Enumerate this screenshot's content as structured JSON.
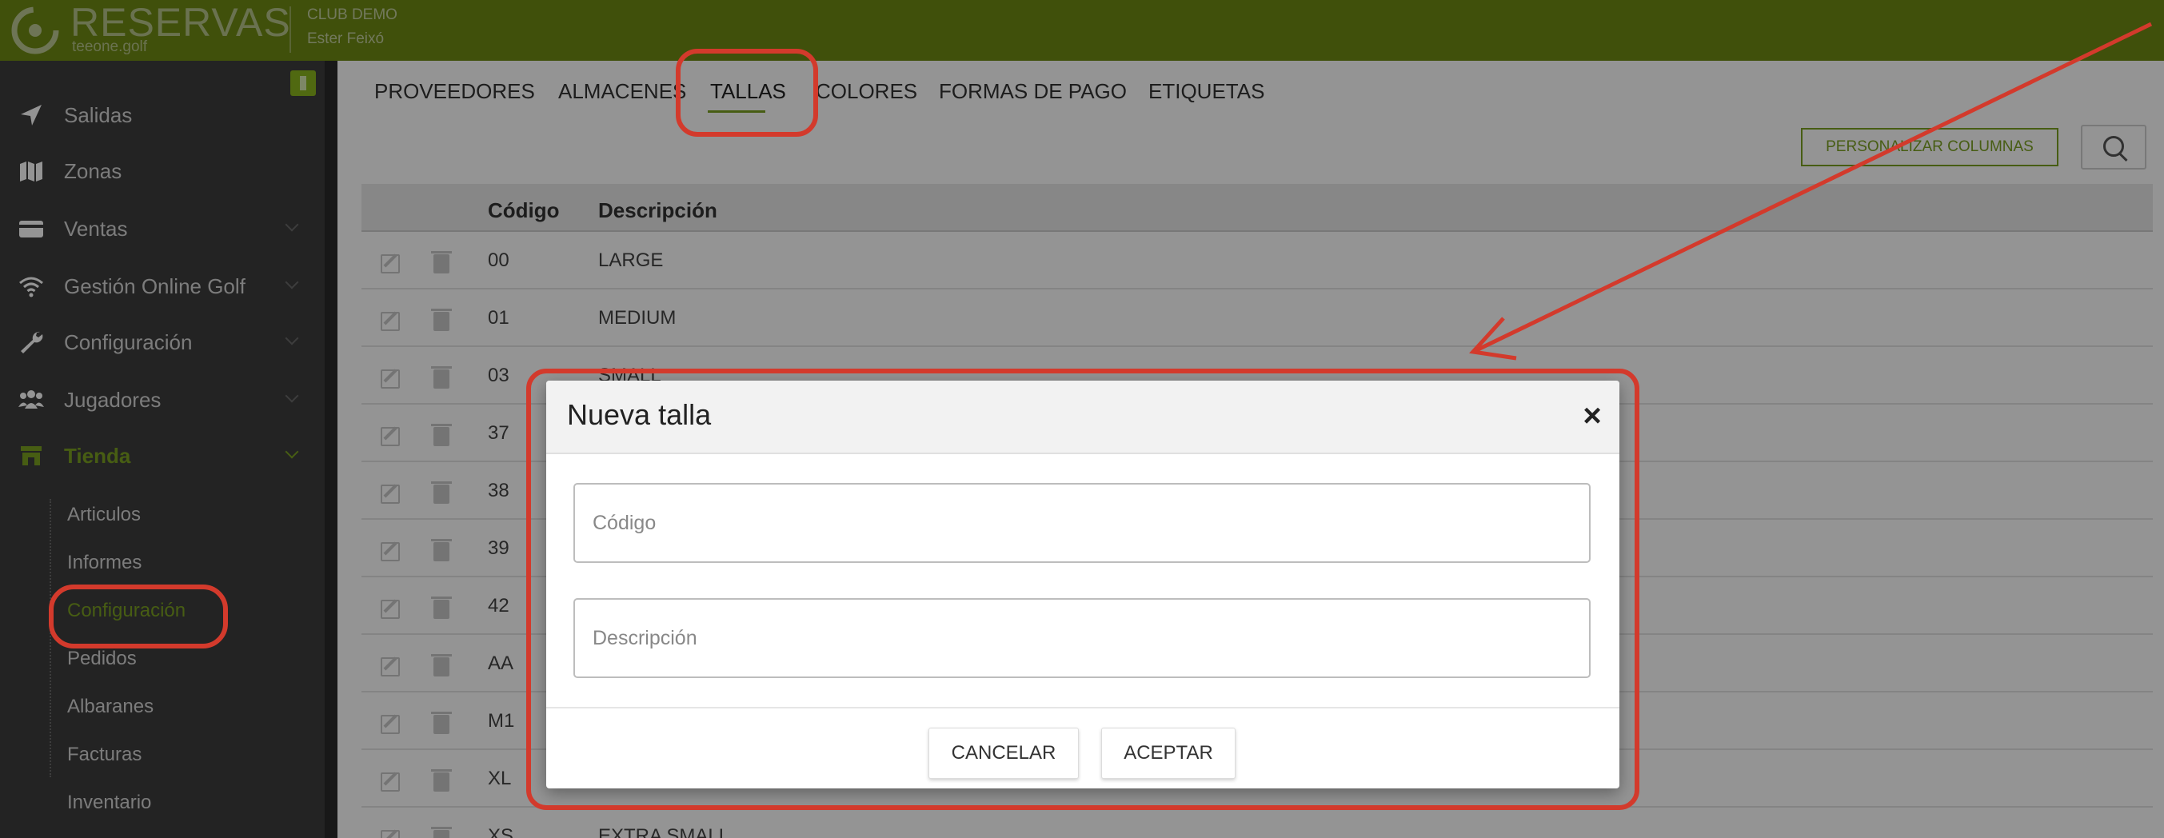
{
  "header": {
    "logo_text": "RESERVAS",
    "logo_sub": "teeone.golf",
    "club_name": "CLUB DEMO",
    "user_name": "Ester Feixó",
    "brand_color": "#6f8a14"
  },
  "sidebar": {
    "items": [
      {
        "label": "Salidas",
        "icon": "send-icon"
      },
      {
        "label": "Zonas",
        "icon": "map-icon"
      },
      {
        "label": "Ventas",
        "icon": "credit-card-icon"
      },
      {
        "label": "Gestión Online Golf",
        "icon": "wifi-icon"
      },
      {
        "label": "Configuración",
        "icon": "wrench-icon"
      },
      {
        "label": "Jugadores",
        "icon": "users-icon"
      },
      {
        "label": "Tienda",
        "icon": "store-icon"
      }
    ],
    "subitems": [
      {
        "label": "Articulos"
      },
      {
        "label": "Informes"
      },
      {
        "label": "Configuración"
      },
      {
        "label": "Pedidos"
      },
      {
        "label": "Albaranes"
      },
      {
        "label": "Facturas"
      },
      {
        "label": "Inventario"
      }
    ],
    "accent_color": "#7ba122"
  },
  "tabs": [
    {
      "label": "PROVEEDORES"
    },
    {
      "label": "ALMACENES"
    },
    {
      "label": "TALLAS"
    },
    {
      "label": "COLORES"
    },
    {
      "label": "FORMAS DE PAGO"
    },
    {
      "label": "ETIQUETAS"
    }
  ],
  "toolbar": {
    "customize_label": "PERSONALIZAR COLUMNAS",
    "search_icon": "search-icon"
  },
  "table": {
    "headers": {
      "code": "Código",
      "description": "Descripción"
    },
    "rows": [
      {
        "code": "00",
        "description": "LARGE"
      },
      {
        "code": "01",
        "description": "MEDIUM"
      },
      {
        "code": "03",
        "description": "SMALL"
      },
      {
        "code": "37",
        "description": ""
      },
      {
        "code": "38",
        "description": ""
      },
      {
        "code": "39",
        "description": ""
      },
      {
        "code": "42",
        "description": ""
      },
      {
        "code": "AA",
        "description": ""
      },
      {
        "code": "M1",
        "description": ""
      },
      {
        "code": "XL",
        "description": ""
      },
      {
        "code": "XS",
        "description": "EXTRA SMALL"
      }
    ]
  },
  "modal": {
    "title": "Nueva talla",
    "close_symbol": "×",
    "code_placeholder": "Código",
    "description_placeholder": "Descripción",
    "cancel_label": "CANCELAR",
    "accept_label": "ACEPTAR"
  },
  "annotation_color": "#d33a2c"
}
